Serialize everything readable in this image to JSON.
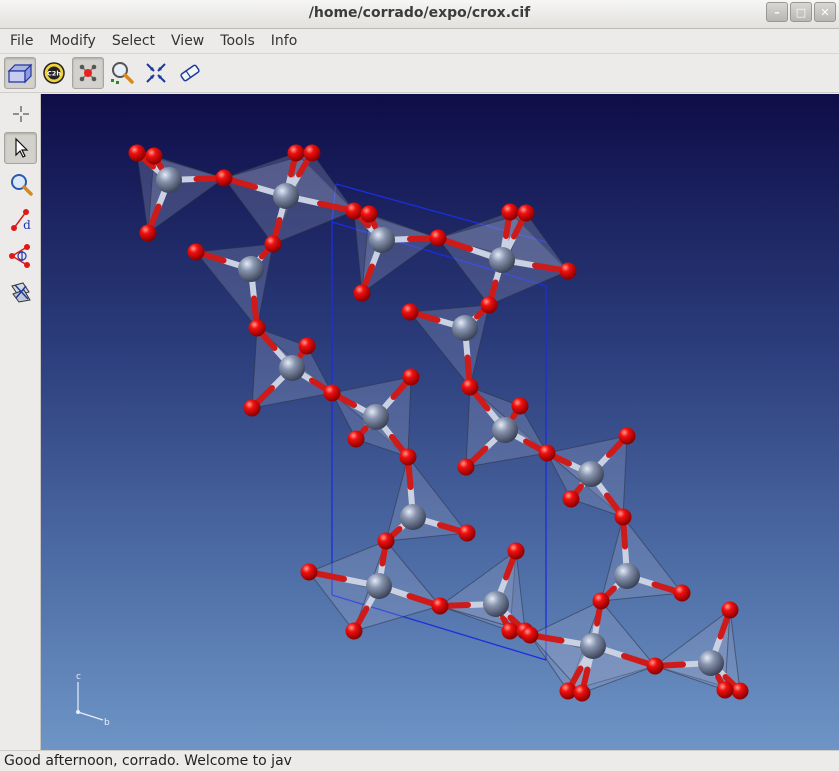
{
  "window": {
    "title": "/home/corrado/expo/crox.cif"
  },
  "menu": {
    "items": [
      "File",
      "Modify",
      "Select",
      "View",
      "Tools",
      "Info"
    ]
  },
  "toolbar": {
    "buttons": [
      "unit-cell-icon",
      "symmetry-c2h-icon",
      "atoms-view-icon",
      "zoom-cursor-icon",
      "center-icon",
      "eraser-icon"
    ],
    "badge": "C2h"
  },
  "sidebar": {
    "buttons": [
      "crosshair-icon",
      "pointer-icon",
      "magnifier-icon",
      "distance-measure-icon",
      "angle-measure-icon",
      "torsion-measure-icon"
    ],
    "distance_label": "d"
  },
  "axes": {
    "c": "c",
    "b": "b"
  },
  "status": {
    "text": "Good afternoon, corrado.  Welcome to jav"
  },
  "colors": {
    "oxygen": "#e80f0f",
    "silicon": "#6a7590",
    "cell_edges": "#1a2ee0",
    "polyhedra": "#9aa6c6"
  }
}
